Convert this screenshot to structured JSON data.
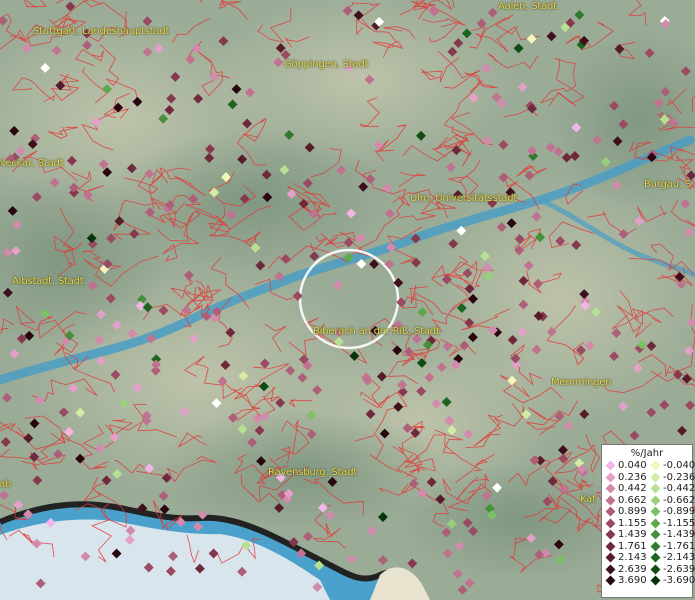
{
  "map": {
    "cities": [
      {
        "name": "Aalen, Stadt",
        "pos": "top"
      },
      {
        "name": "Stuttgart, Landeshauptstadt",
        "pos": "top-left"
      },
      {
        "name": "Göppingen, Stadt",
        "pos": "top"
      },
      {
        "name": "Neckar, Stadt",
        "pos": "left"
      },
      {
        "name": "Ulm, Universitätsstadt",
        "pos": "center-right"
      },
      {
        "name": "Burgau, S",
        "pos": "right"
      },
      {
        "name": "Albstadt, Stadt",
        "pos": "left"
      },
      {
        "name": "Biberach an der Riß, Stadt",
        "pos": "center"
      },
      {
        "name": "Memmingen",
        "pos": "right"
      },
      {
        "name": "Ravensburg, Stadt",
        "pos": "bottom"
      },
      {
        "name": "ab",
        "pos": "bottom-left"
      },
      {
        "name": "Kat",
        "pos": "bottom-right"
      }
    ],
    "colors": {
      "district_borders": "#e23a3a",
      "water": "#4a9ec4",
      "terrain": "#9aab96",
      "label": "#e8d84a"
    },
    "marker_icon": "diamond-marker-icon",
    "highlight_icon": "selection-circle-icon"
  },
  "legend": {
    "title": "%/Jahr",
    "rows": [
      {
        "left": "0.040",
        "left_color": "#f2b6e6",
        "right": "-0.040",
        "right_color": "#f2f6b8"
      },
      {
        "left": "0.236",
        "left_color": "#e3a0c8",
        "right": "-0.236",
        "right_color": "#d2eca4"
      },
      {
        "left": "0.442",
        "left_color": "#d28aad",
        "right": "-0.442",
        "right_color": "#b8e094"
      },
      {
        "left": "0.662",
        "left_color": "#c07390",
        "right": "-0.662",
        "right_color": "#98d07e"
      },
      {
        "left": "0.899",
        "left_color": "#ad5f7a",
        "right": "-0.899",
        "right_color": "#7cc066"
      },
      {
        "left": "1.155",
        "left_color": "#9a4a62",
        "right": "-1.155",
        "right_color": "#5ea84e"
      },
      {
        "left": "1.439",
        "left_color": "#85384e",
        "right": "-1.439",
        "right_color": "#44903c"
      },
      {
        "left": "1.761",
        "left_color": "#6e2a3c",
        "right": "-1.761",
        "right_color": "#2e7a2e"
      },
      {
        "left": "2.143",
        "left_color": "#561c2a",
        "right": "-2.143",
        "right_color": "#1c6420"
      },
      {
        "left": "2.639",
        "left_color": "#3e101c",
        "right": "-2.639",
        "right_color": "#0e4c14"
      },
      {
        "left": "3.690",
        "left_color": "#27060e",
        "right": "-3.690",
        "right_color": "#06340a"
      }
    ]
  }
}
